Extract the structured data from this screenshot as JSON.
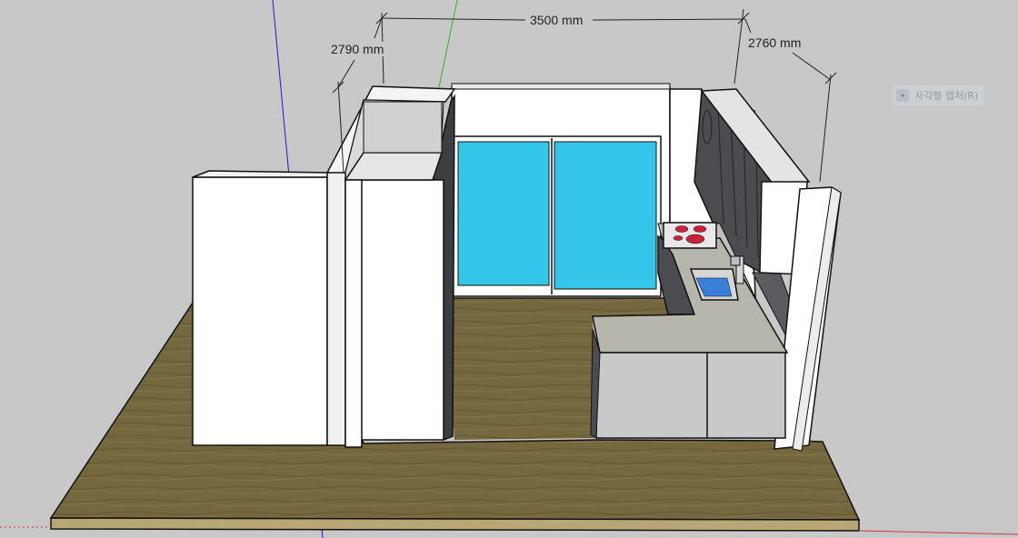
{
  "app": {
    "name": "",
    "view": "3D perspective model viewport"
  },
  "dimensions": {
    "width_label": "3500 mm",
    "left_depth_label": "2790 mm",
    "right_depth_label": "2760 mm"
  },
  "overlay": {
    "capture_hint": "사각형 캡처(R)",
    "capture_hint_icon": "capture-icon"
  },
  "colors": {
    "background": "#c8c8c8",
    "floor": "#75683f",
    "floor_edge": "#b8a774",
    "wall": "#ffffff",
    "window_glass": "#33c6e8",
    "countertop": "#b6b6ad",
    "cabinet_front": "#c9c9c9",
    "dark_cabinet": "#4a4c50",
    "axis_blue": "#1a1acc",
    "axis_green": "#2ab52a",
    "axis_red": "#d23c3c",
    "burner_red": "#cc1f3a",
    "sink_water": "#3a7fd9"
  }
}
